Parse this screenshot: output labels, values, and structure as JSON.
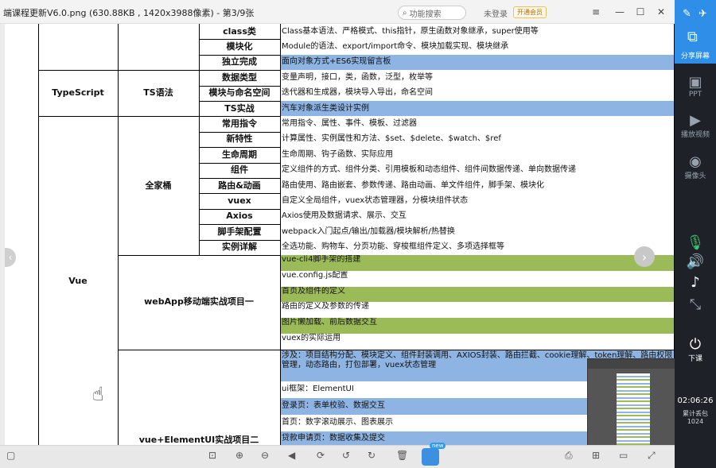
{
  "window": {
    "title": "端课程更新V6.0.png (630.88KB , 1420x3988像素) - 第3/9张",
    "search_placeholder": "功能搜索",
    "login": "未登录",
    "vip": "开通会员"
  },
  "table": {
    "rows": [
      {
        "cat": "",
        "topic": "",
        "sub": "class类",
        "desc": "Class基本语法、严格模式、this指针，原生函数对象继承，super使用等",
        "color": "white"
      },
      {
        "cat": "",
        "topic": "",
        "sub": "模块化",
        "desc": "Module的语法、export/import命令、模块加载实现、模块继承",
        "color": "white"
      },
      {
        "cat": "",
        "topic": "",
        "sub": "独立完成",
        "desc": "面向对象方式+ES6实现留言板",
        "color": "blue"
      },
      {
        "cat": "TypeScript",
        "topic": "TS语法",
        "sub": "数据类型",
        "desc": "变量声明，接口，类，函数，泛型，枚举等",
        "color": "white"
      },
      {
        "cat": "",
        "topic": "",
        "sub": "模块与命名空间",
        "desc": "迭代器和生成器，模块导入导出，命名空间",
        "color": "white"
      },
      {
        "cat": "",
        "topic": "",
        "sub": "TS实战",
        "desc": "汽车对象派生类设计实例",
        "color": "blue"
      },
      {
        "cat": "",
        "topic": "全家桶",
        "sub": "常用指令",
        "desc": "常用指令、属性、事件、模板、过滤器",
        "color": "white"
      },
      {
        "cat": "",
        "topic": "",
        "sub": "新特性",
        "desc": "计算属性、实例属性和方法、$set、$delete、$watch、$ref",
        "color": "white"
      },
      {
        "cat": "",
        "topic": "",
        "sub": "生命周期",
        "desc": "生命周期、钩子函数、实际应用",
        "color": "white"
      },
      {
        "cat": "",
        "topic": "",
        "sub": "组件",
        "desc": "定义组件的方式、组件分类、引用模板和动态组件、组件间数据传递、单向数据传递",
        "color": "white"
      },
      {
        "cat": "",
        "topic": "",
        "sub": "路由&动画",
        "desc": "路由使用、路由嵌套、参数传递、路由动画、单文件组件，脚手架、模块化",
        "color": "white"
      },
      {
        "cat": "",
        "topic": "",
        "sub": "vuex",
        "desc": "自定义全局组件，vuex状态管理器，分模块组件状态",
        "color": "white"
      },
      {
        "cat": "",
        "topic": "",
        "sub": "Axios",
        "desc": "Axios使用及数据请求、展示、交互",
        "color": "white"
      },
      {
        "cat": "",
        "topic": "",
        "sub": "脚手架配置",
        "desc": "webpack入门起点/输出/加载器/模块解析/热替换",
        "color": "white"
      },
      {
        "cat": "",
        "topic": "",
        "sub": "实例详解",
        "desc": "全选功能、购物车、分页功能、穿梭框组件定义、多项选择框等",
        "color": "white"
      }
    ],
    "project1": {
      "topic": "webApp移动端实战项目一",
      "items": [
        {
          "text": "vue-cli4脚手架的搭建",
          "color": "olive"
        },
        {
          "text": "vue.config.js配置",
          "color": "white"
        },
        {
          "text": "首页及组件的定义",
          "color": "olive"
        },
        {
          "text": "路由的定义及参数的传递",
          "color": "white"
        },
        {
          "text": "图片懒加载、前后数据交互",
          "color": "olive"
        },
        {
          "text": "vuex的实际运用",
          "color": "white"
        }
      ]
    },
    "project2": {
      "topic": "vue+ElementUI实战项目二",
      "items": [
        {
          "text": "涉及：项目结构分配、模块定义、组件封装调用、AXIOS封装、路由拦截、cookie理解、token理解、路由权限管理，动态路由，打包部署，vuex状态管理",
          "color": "blue"
        },
        {
          "text": "ui框架：ElementUI",
          "color": "white"
        },
        {
          "text": "登录页：表单校验、数据交互",
          "color": "blue"
        },
        {
          "text": "首页：数字滚动展示、图表展示",
          "color": "white"
        },
        {
          "text": "贷款申请页：数据收集及提交",
          "color": "blue"
        }
      ]
    },
    "vue_label": "Vue"
  },
  "bottombar": {
    "new_badge": "new"
  },
  "rightpanel": {
    "share": "分享屏幕",
    "ppt": "PPT",
    "video": "播放视频",
    "camera": "摄像头",
    "end": "下课",
    "time": "02:06:26",
    "stats_line1": "累计丢包",
    "stats_line2": "1024"
  }
}
